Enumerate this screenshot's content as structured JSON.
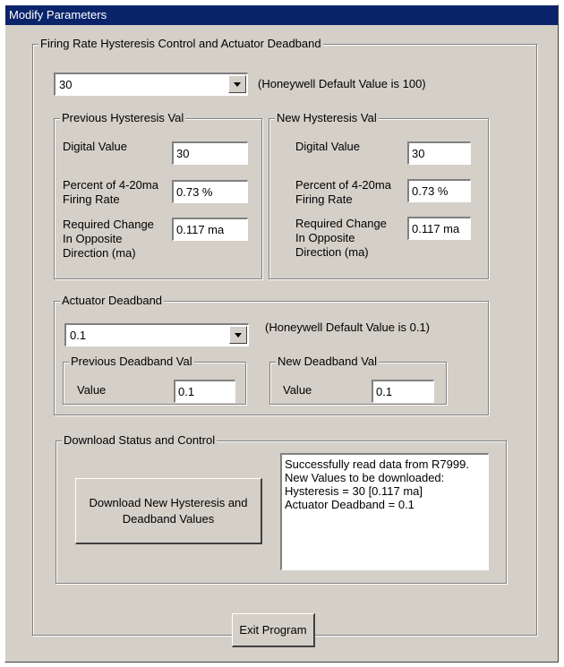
{
  "window": {
    "title": "Modify Parameters"
  },
  "firing_rate": {
    "group_label": "Firing Rate Hysteresis Control and Actuator Deadband",
    "selected_value": "30",
    "default_note": "(Honeywell Default Value is 100)",
    "previous": {
      "group_label": "Previous Hysteresis Val",
      "digital_label": "Digital Value",
      "digital_value": "30",
      "percent_label_line1": "Percent of 4-20ma",
      "percent_label_line2": "Firing Rate",
      "percent_value": "0.73 %",
      "change_label_line1": "Required Change",
      "change_label_line2": "In Opposite",
      "change_label_line3": "Direction (ma)",
      "change_value": "0.117 ma"
    },
    "new": {
      "group_label": "New Hysteresis Val",
      "digital_label": "Digital Value",
      "digital_value": "30",
      "percent_label_line1": "Percent of 4-20ma",
      "percent_label_line2": "Firing Rate",
      "percent_value": "0.73 %",
      "change_label_line1": "Required Change",
      "change_label_line2": "In Opposite",
      "change_label_line3": "Direction (ma)",
      "change_value": "0.117 ma"
    }
  },
  "deadband": {
    "group_label": "Actuator Deadband",
    "selected_value": "0.1",
    "default_note": "(Honeywell Default Value is 0.1)",
    "previous": {
      "group_label": "Previous Deadband Val",
      "value_label": "Value",
      "value": "0.1"
    },
    "new": {
      "group_label": "New Deadband Val",
      "value_label": "Value",
      "value": "0.1"
    }
  },
  "download": {
    "group_label": "Download Status and Control",
    "button_line1": "Download New Hysteresis and",
    "button_line2": "Deadband Values",
    "status_lines": [
      "Successfully read data from R7999.",
      "New Values to be downloaded:",
      "Hysteresis =  30  [0.117 ma]",
      "Actuator Deadband = 0.1"
    ]
  },
  "exit_button": "Exit Program",
  "colors": {
    "face": "#d4d0c8",
    "titlebar": "#0a246a",
    "titlebar_text": "#ffffff"
  }
}
